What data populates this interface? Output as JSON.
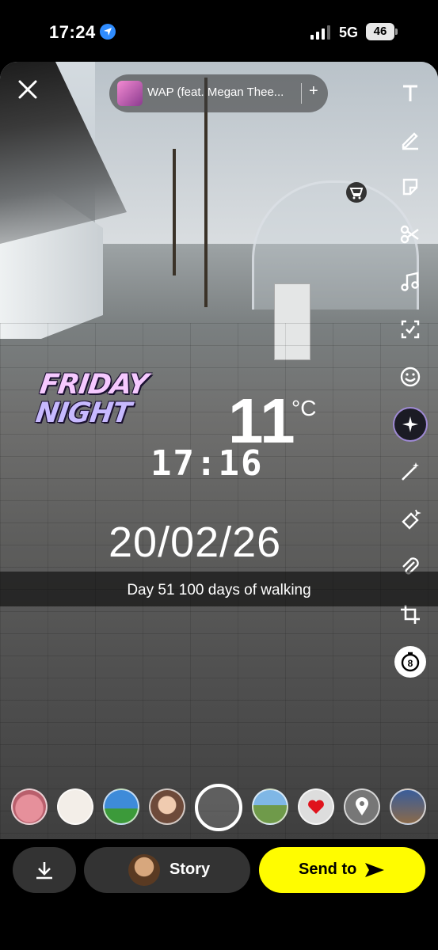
{
  "status_bar": {
    "time": "17:24",
    "network": "5G",
    "battery": "46"
  },
  "music": {
    "title": "WAP (feat. Megan Thee...",
    "add": "+"
  },
  "tools": [
    {
      "name": "text-icon"
    },
    {
      "name": "pencil-icon"
    },
    {
      "name": "sticker-icon"
    },
    {
      "name": "scissors-icon"
    },
    {
      "name": "music-note-icon"
    },
    {
      "name": "scan-icon"
    },
    {
      "name": "smiley-icon"
    },
    {
      "name": "ai-sparkle-icon"
    },
    {
      "name": "magic-wand-icon"
    },
    {
      "name": "eraser-icon"
    },
    {
      "name": "paperclip-icon"
    },
    {
      "name": "crop-icon"
    },
    {
      "name": "timer-icon"
    }
  ],
  "stickers": {
    "friday_line1": "FRIDAY",
    "friday_line2": "NIGHT",
    "temperature": "11",
    "temperature_unit": "°C",
    "clock": "17:16",
    "date": "20/02/26"
  },
  "caption": "Day 51 100 days of walking",
  "lenses": [
    {
      "name": "pig-lens"
    },
    {
      "name": "saturday-lens"
    },
    {
      "name": "beach-lens"
    },
    {
      "name": "face-lens"
    },
    {
      "name": "landscape-lens"
    },
    {
      "name": "heart-lens"
    },
    {
      "name": "location-lens"
    },
    {
      "name": "landscape-text-lens"
    }
  ],
  "bottom_bar": {
    "story_label": "Story",
    "send_label": "Send to"
  },
  "colors": {
    "send_button": "#fffc00",
    "pill_bg": "#333333"
  }
}
